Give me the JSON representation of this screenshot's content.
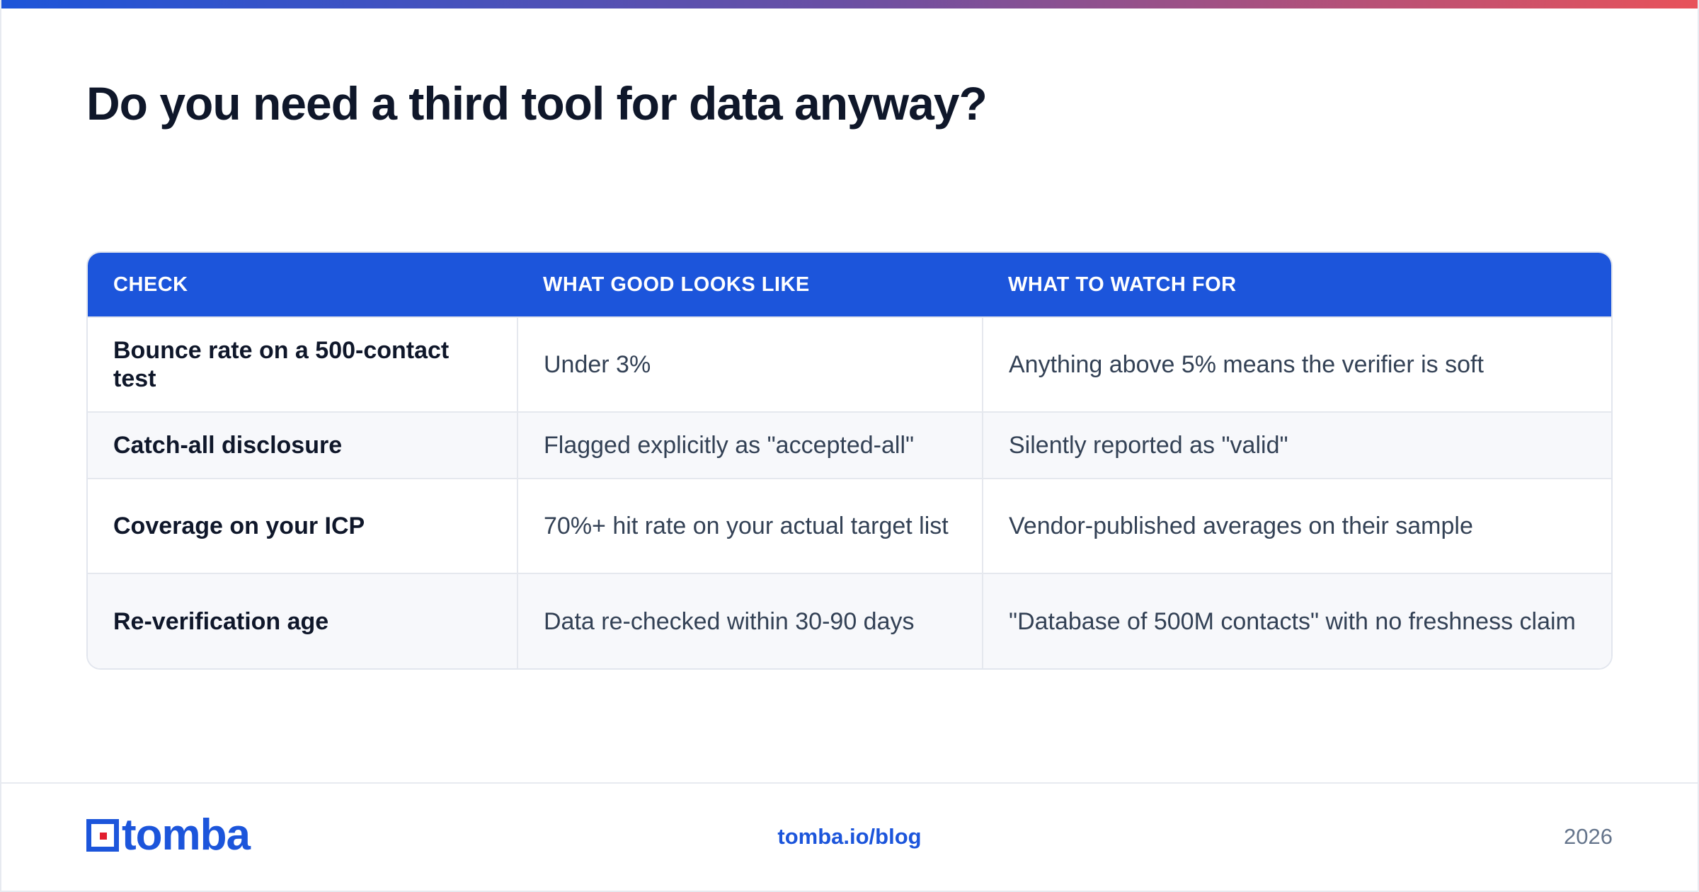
{
  "page": {
    "title": "Do you need a third tool for data anyway?"
  },
  "table": {
    "headers": [
      "CHECK",
      "WHAT GOOD LOOKS LIKE",
      "WHAT TO WATCH FOR"
    ],
    "rows": [
      [
        "Bounce rate on a 500-contact test",
        "Under 3%",
        "Anything above 5% means the verifier is soft"
      ],
      [
        "Catch-all disclosure",
        "Flagged explicitly as \"accepted-all\"",
        "Silently reported as \"valid\""
      ],
      [
        "Coverage on your ICP",
        "70%+ hit rate on your actual target list",
        "Vendor-published averages on their sample"
      ],
      [
        "Re-verification age",
        "Data re-checked within 30-90 days",
        "\"Database of 500M contacts\" with no freshness claim"
      ]
    ]
  },
  "footer": {
    "logo_text": "tomba",
    "link": "tomba.io/blog",
    "year": "2026"
  },
  "colors": {
    "accent": "#1c55db",
    "logo_dot": "#e11d2e",
    "gradient_start": "#1d55d9",
    "gradient_end": "#e8525a"
  },
  "icons": {
    "logo": "tomba-logo-icon"
  }
}
